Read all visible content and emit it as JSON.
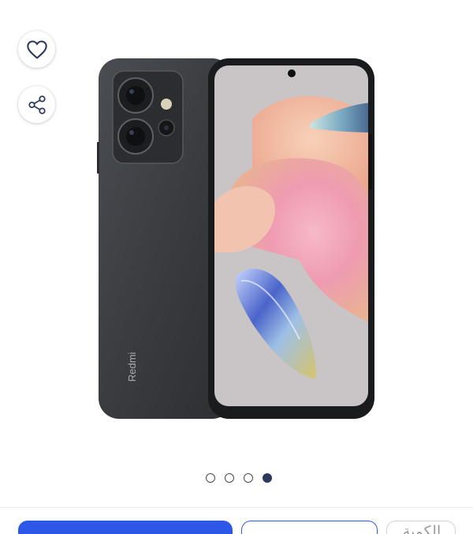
{
  "product": {
    "brand_mark": "Redmi"
  },
  "actions": {
    "favorite_icon": "heart-icon",
    "share_icon": "share-icon"
  },
  "gallery": {
    "image_count": 4,
    "active_index": 4
  },
  "bottom_bar": {
    "quantity_label": "الكمية",
    "accent_color": "#2d57e6"
  }
}
